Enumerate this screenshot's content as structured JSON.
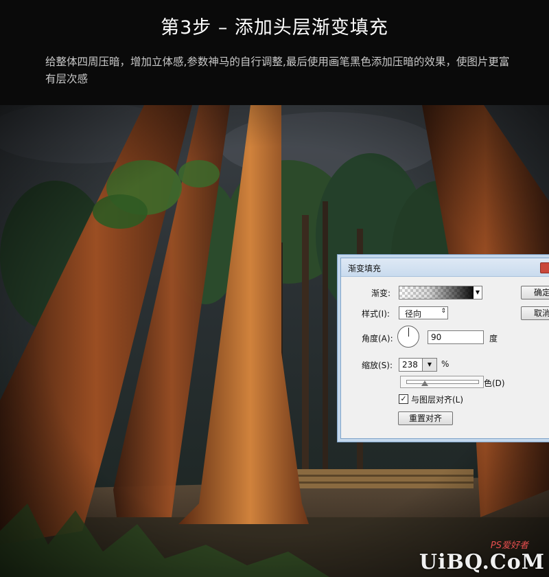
{
  "header": {
    "title": "第3步 – 添加头层渐变填充",
    "description": "给整体四周压暗，增加立体感,参数神马的自行调整,最后使用画笔黑色添加压暗的效果，使图片更富有层次感"
  },
  "dialog": {
    "title": "渐变填充",
    "gradient_label": "渐变:",
    "style_label": "样式(I):",
    "style_value": "径向",
    "angle_label": "角度(A):",
    "angle_value": "90",
    "angle_unit": "度",
    "scale_label": "缩放(S):",
    "scale_value": "238",
    "scale_unit": "%",
    "reverse_partial": "色(D)",
    "align_label": "与图层对齐(L)",
    "align_checked": true,
    "reset_align_button": "重置对齐",
    "ok_button": "确定",
    "cancel_button": "取消"
  },
  "watermark": {
    "top": "PS爱好者",
    "main": "UiBQ.CoM"
  }
}
